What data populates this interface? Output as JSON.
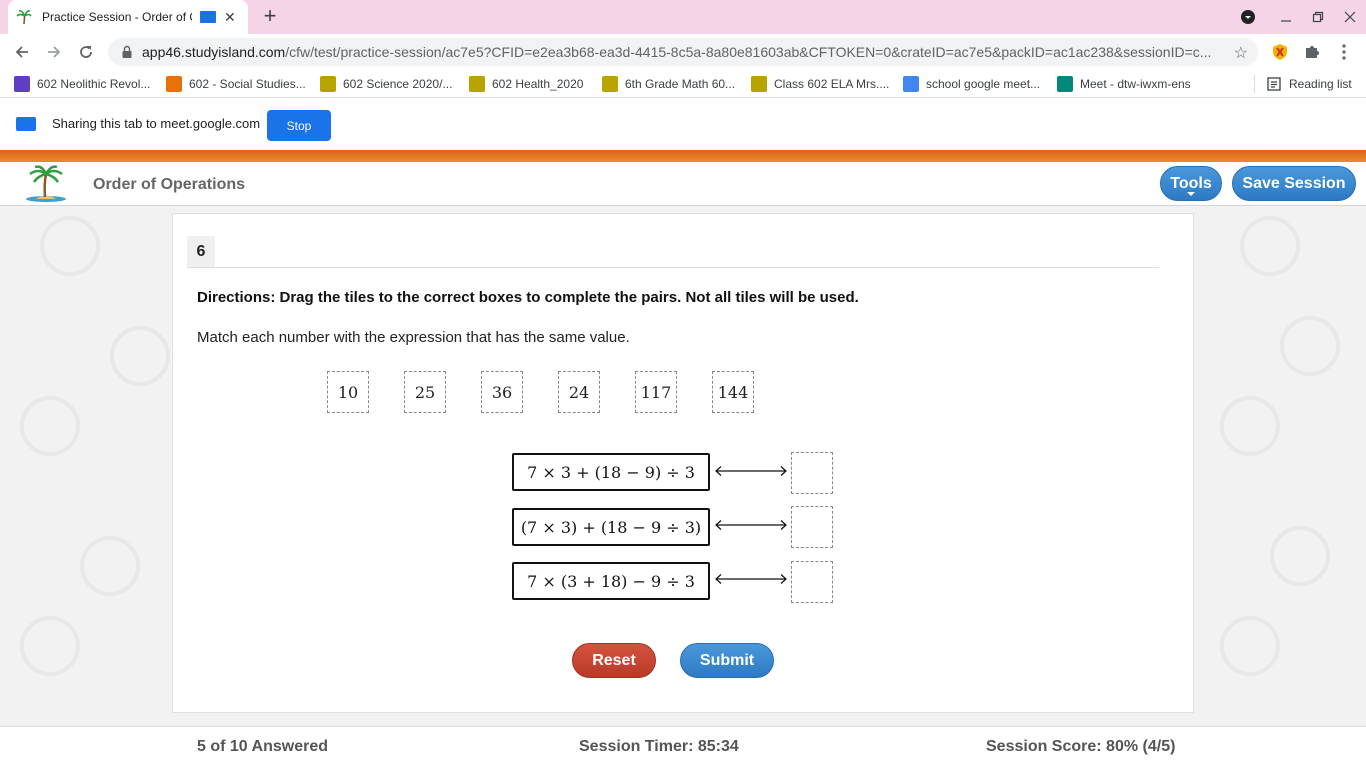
{
  "browser": {
    "tab_title": "Practice Session - Order of O",
    "url_host": "app46.studyisland.com",
    "url_path": "/cfw/test/practice-session/ac7e5?CFID=e2ea3b68-ea3d-4415-8c5a-8a80e81603ab&CFTOKEN=0&crateID=ac7e5&packID=ac1ac238&sessionID=c...",
    "bookmarks": [
      {
        "label": "602 Neolithic Revol...",
        "color": "#5f3dc4"
      },
      {
        "label": "602 - Social Studies...",
        "color": "#e8710a"
      },
      {
        "label": "602 Science 2020/...",
        "color": "#b8a300"
      },
      {
        "label": "602 Health_2020",
        "color": "#b8a300"
      },
      {
        "label": "6th Grade Math 60...",
        "color": "#b8a300"
      },
      {
        "label": "Class 602 ELA Mrs....",
        "color": "#b8a300"
      },
      {
        "label": "school google meet...",
        "color": "#4285f4"
      },
      {
        "label": "Meet - dtw-iwxm-ens",
        "color": "#00897b"
      }
    ],
    "reading_list": "Reading list",
    "share_text": "Sharing this tab to meet.google.com",
    "stop_label": "Stop"
  },
  "header": {
    "title": "Order of Operations",
    "tools_label": "Tools",
    "save_label": "Save Session"
  },
  "question": {
    "number": "6",
    "directions": "Directions: Drag the tiles to the correct boxes to complete the pairs. Not all tiles will be used.",
    "prompt": "Match each number with the expression that has the same value.",
    "tiles": [
      "10",
      "25",
      "36",
      "24",
      "117",
      "144"
    ],
    "expressions": [
      "7 × 3 + (18 − 9) ÷ 3",
      "(7 × 3) + (18 − 9 ÷ 3)",
      "7 × (3 + 18) − 9 ÷ 3"
    ],
    "reset_label": "Reset",
    "submit_label": "Submit"
  },
  "footer": {
    "answered": "5 of 10 Answered",
    "timer": "Session Timer: 85:34",
    "score": "Session Score: 80% (4/5)"
  }
}
